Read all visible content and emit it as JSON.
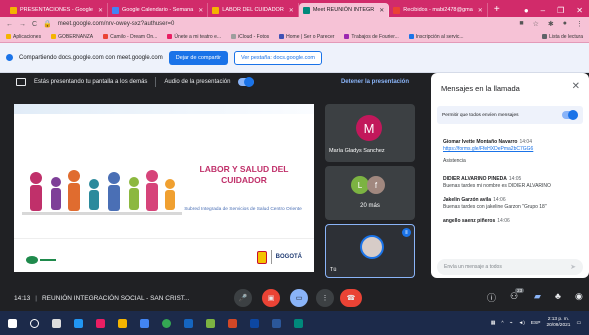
{
  "browser": {
    "tabs": [
      {
        "label": "PRESENTACIONES - Google",
        "color": "#f4b400"
      },
      {
        "label": "Google Calendario - Semana",
        "color": "#4285f4"
      },
      {
        "label": "LABOR DEL CUIDADOR",
        "color": "#f4b400"
      },
      {
        "label": "Meet REUNIÓN INTEGR",
        "color": "#00897b"
      },
      {
        "label": "Recibidos - mabi2478@gma",
        "color": "#ea4335"
      }
    ],
    "new_tab": "+",
    "url": "meet.google.com/nrv-owey-sxz?authuser=0",
    "bookmarks": [
      "Aplicaciones",
      "GOBERNANZA",
      "Camilo - Dream On...",
      "Únete a mi teatro e...",
      "iCloud - Fotos",
      "Home | Ser o Parecer",
      "Trabajos de Fourier...",
      "Inscripción al servic..."
    ],
    "bookmarks_right": "Lista de lectura"
  },
  "share_banner": {
    "text": "Compartiendo docs.google.com con meet.google.com",
    "stop_button": "Dejar de compartir",
    "switch_button": "Ver pestaña: docs.google.com"
  },
  "presentation_bar": {
    "status": "Estás presentando tu pantalla a los demás",
    "audio_label": "Audio de la presentación",
    "stop_label": "Detener la presentación"
  },
  "slide": {
    "title": "LABOR Y SALUD DEL CUIDADOR",
    "subtitle": "Subred Integrada de Servicios de Salud Centro Oriente",
    "logo_text": "BOGOTÁ"
  },
  "tiles": {
    "main": {
      "initial": "M",
      "name": "María Gladys Sanchez",
      "color": "#c2185b"
    },
    "more": {
      "initial1": "L",
      "initial2": "f",
      "count": "20 más"
    },
    "self": {
      "name": "Tú"
    }
  },
  "chat": {
    "title": "Mensajes en la llamada",
    "permission_label": "Permitir que todos envíen mensajes",
    "messages": [
      {
        "author": "Giomar Ivette Montaño Navarro",
        "time": "14:04",
        "text": "https://forms.gle/FfeHXDePma2bC7GG6",
        "is_link": true,
        "extra": "Asistencia"
      },
      {
        "author": "DIDIER ALVARINO PINEDA",
        "time": "14:05",
        "text": "Buenas tardes mi nombre es DIDIER ALVARINO",
        "is_link": false,
        "extra": ""
      },
      {
        "author": "Jakelin Garzón avila",
        "time": "14:06",
        "text": "Buenas tardes con jakeline Garzon \"Grupo 18\"",
        "is_link": false,
        "extra": ""
      },
      {
        "author": "angello saenz piñeros",
        "time": "14:06",
        "text": "",
        "is_link": false,
        "extra": ""
      }
    ],
    "input_placeholder": "Envía un mensaje a todos"
  },
  "call_bar": {
    "time": "14:13",
    "meeting_name": "REUNIÓN INTEGRACIÓN SOCIAL - SAN CRIST...",
    "participants_badge": "23"
  },
  "taskbar": {
    "language": "ESP",
    "time": "2:13 p. m.",
    "date": "20/09/2021"
  },
  "colors": {
    "accent": "#1a73e8",
    "end_call": "#ea4335",
    "browser_frame": "#d12b6a"
  }
}
